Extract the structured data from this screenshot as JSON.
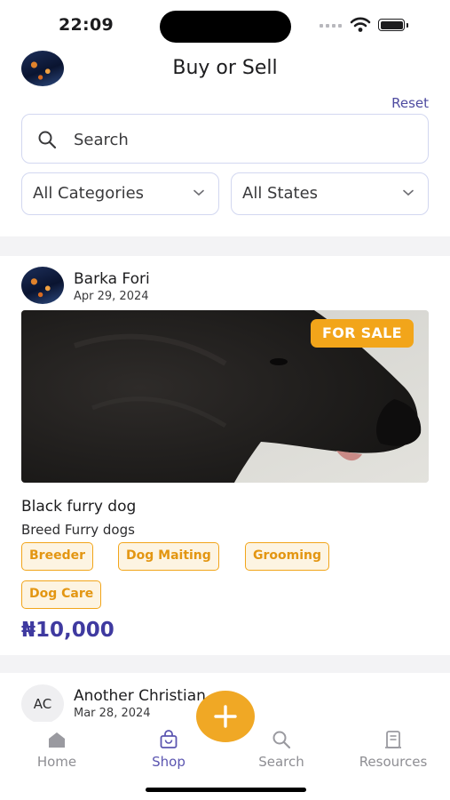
{
  "status_bar": {
    "time": "22:09"
  },
  "header": {
    "title": "Buy or Sell",
    "reset_label": "Reset"
  },
  "search": {
    "placeholder": "Search",
    "value": ""
  },
  "filters": {
    "category": "All Categories",
    "state": "All States"
  },
  "posts": [
    {
      "seller": "Barka Fori",
      "date": "Apr 29, 2024",
      "badge": "FOR SALE",
      "title": "Black furry dog",
      "breed": "Breed Furry dogs",
      "tags": [
        "Breeder",
        "Dog Maiting",
        "Grooming",
        "Dog Care"
      ],
      "price": "₦10,000"
    },
    {
      "avatar_initials": "AC",
      "seller": "Another Christian",
      "date": "Mar 28, 2024"
    }
  ],
  "tabs": [
    {
      "label": "Home",
      "icon": "home-icon"
    },
    {
      "label": "Shop",
      "icon": "shop-bag-icon",
      "active": true
    },
    {
      "label": "Search",
      "icon": "search-icon"
    },
    {
      "label": "Resources",
      "icon": "resources-icon"
    }
  ],
  "fab": {
    "icon": "plus-icon"
  },
  "colors": {
    "accent": "#f2a51a",
    "brand": "#3f3aa0",
    "link": "#4e4ba0",
    "active_tab": "#5b55b0"
  }
}
